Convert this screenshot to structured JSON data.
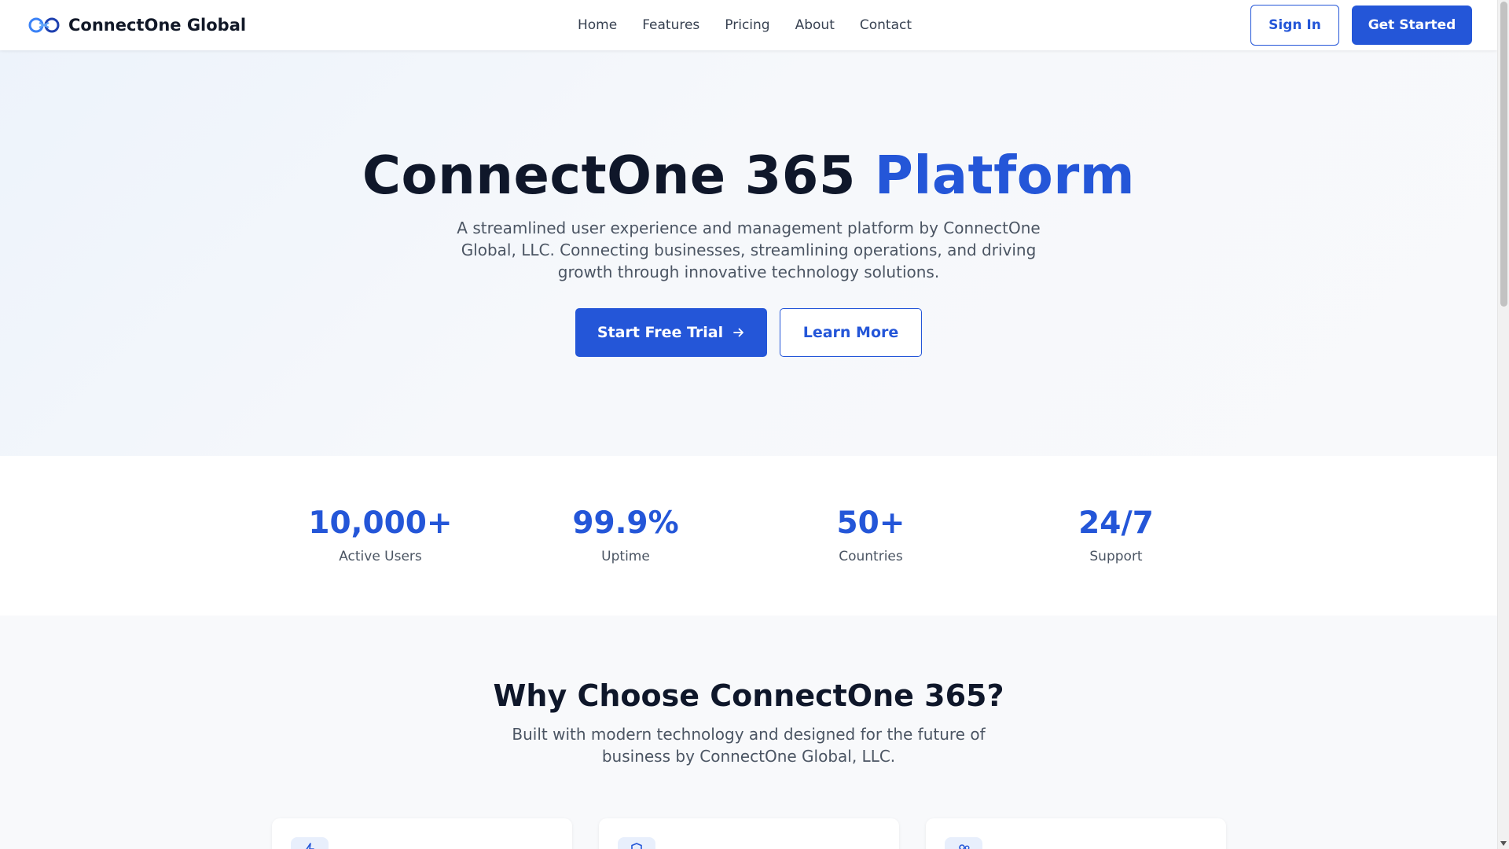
{
  "navbar": {
    "brand": "ConnectOne Global",
    "logo_icon": "infinity-link-icon",
    "links": [
      "Home",
      "Features",
      "Pricing",
      "About",
      "Contact"
    ],
    "sign_in": "Sign In",
    "get_started": "Get Started"
  },
  "hero": {
    "title_main": "ConnectOne 365",
    "title_accent": "Platform",
    "subtitle": "A streamlined user experience and management platform by ConnectOne Global, LLC. Connecting businesses, streamlining operations, and driving growth through innovative technology solutions.",
    "primary_cta": "Start Free Trial",
    "primary_cta_icon": "arrow-right-icon",
    "secondary_cta": "Learn More"
  },
  "stats": [
    {
      "value": "10,000+",
      "label": "Active Users"
    },
    {
      "value": "99.9%",
      "label": "Uptime"
    },
    {
      "value": "50+",
      "label": "Countries"
    },
    {
      "value": "24/7",
      "label": "Support"
    }
  ],
  "features": {
    "title": "Why Choose ConnectOne 365?",
    "subtitle": "Built with modern technology and designed for the future of business by ConnectOne Global, LLC.",
    "card_icons": [
      "lightning-icon",
      "shield-icon",
      "users-icon"
    ]
  },
  "colors": {
    "brand_blue": "#2456d8",
    "heading": "#0f172a",
    "body_text": "#4b5563",
    "icon_bg": "#e8effc"
  }
}
